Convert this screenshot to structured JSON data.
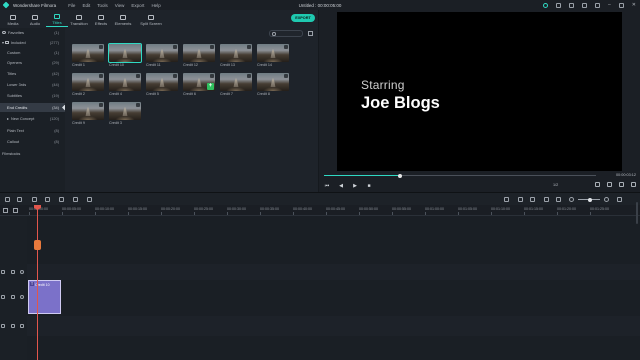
{
  "app": {
    "name": "Wondershare Filmora",
    "document_title": "Untitled : 00:00:05:00"
  },
  "menu": [
    "File",
    "Edit",
    "Tools",
    "View",
    "Export",
    "Help"
  ],
  "tabs": [
    {
      "label": "Media",
      "icon": "folder-icon"
    },
    {
      "label": "Audio",
      "icon": "music-note-icon"
    },
    {
      "label": "Titles",
      "icon": "text-t-icon",
      "active": true
    },
    {
      "label": "Transition",
      "icon": "transition-icon"
    },
    {
      "label": "Effects",
      "icon": "effects-icon"
    },
    {
      "label": "Elements",
      "icon": "elements-icon"
    },
    {
      "label": "Split Screen",
      "icon": "split-screen-icon"
    }
  ],
  "export_label": "EXPORT",
  "sidebar": {
    "items": [
      {
        "label": "Favorites",
        "count": "(1)"
      },
      {
        "label": "Included",
        "count": "(277)"
      },
      {
        "label": "Custom",
        "count": "(1)"
      },
      {
        "label": "Openers",
        "count": "(29)"
      },
      {
        "label": "Titles",
        "count": "(42)"
      },
      {
        "label": "Lower 3rds",
        "count": "(44)"
      },
      {
        "label": "Subtitles",
        "count": "(19)"
      },
      {
        "label": "End Credits",
        "count": "(34)",
        "active": true
      },
      {
        "label": "New Concept",
        "count": "(120)"
      },
      {
        "label": "Plain Text",
        "count": "(8)"
      },
      {
        "label": "Callout",
        "count": "(8)"
      }
    ],
    "filmstocks_label": "Filmstocks"
  },
  "thumbnails": [
    {
      "label": "Credit 1"
    },
    {
      "label": "Credit 10",
      "selected": true
    },
    {
      "label": "Credit 11"
    },
    {
      "label": "Credit 12"
    },
    {
      "label": "Credit 13"
    },
    {
      "label": "Credit 14"
    },
    {
      "label": "Credit 2"
    },
    {
      "label": "Credit 4"
    },
    {
      "label": "Credit 5"
    },
    {
      "label": "Credit 6",
      "badge": "+"
    },
    {
      "label": "Credit 7"
    },
    {
      "label": "Credit 8"
    },
    {
      "label": "Credit 9"
    },
    {
      "label": "Credit 3"
    }
  ],
  "preview": {
    "starring": "Starring",
    "name": "Joe Blogs",
    "timecode": "00:00:03:12",
    "progress": 0.28,
    "ratio": "1/2"
  },
  "ruler_labels": [
    "00:00:00:00",
    "00:00:05:00",
    "00:00:10:00",
    "00:00:15:00",
    "00:00:20:00",
    "00:00:25:00",
    "00:00:30:00",
    "00:00:35:00",
    "00:00:40:00",
    "00:00:45:00",
    "00:00:50:00",
    "00:00:55:00",
    "00:01:00:00",
    "00:01:05:00",
    "00:01:10:00",
    "00:01:15:00",
    "00:01:20:00",
    "00:01:25:00"
  ],
  "clip": {
    "name": "Credit 10",
    "type_glyph": "T"
  },
  "colors": {
    "accent": "#2fd9c3",
    "playhead": "#e2564c",
    "clip": "#7b71c9"
  }
}
